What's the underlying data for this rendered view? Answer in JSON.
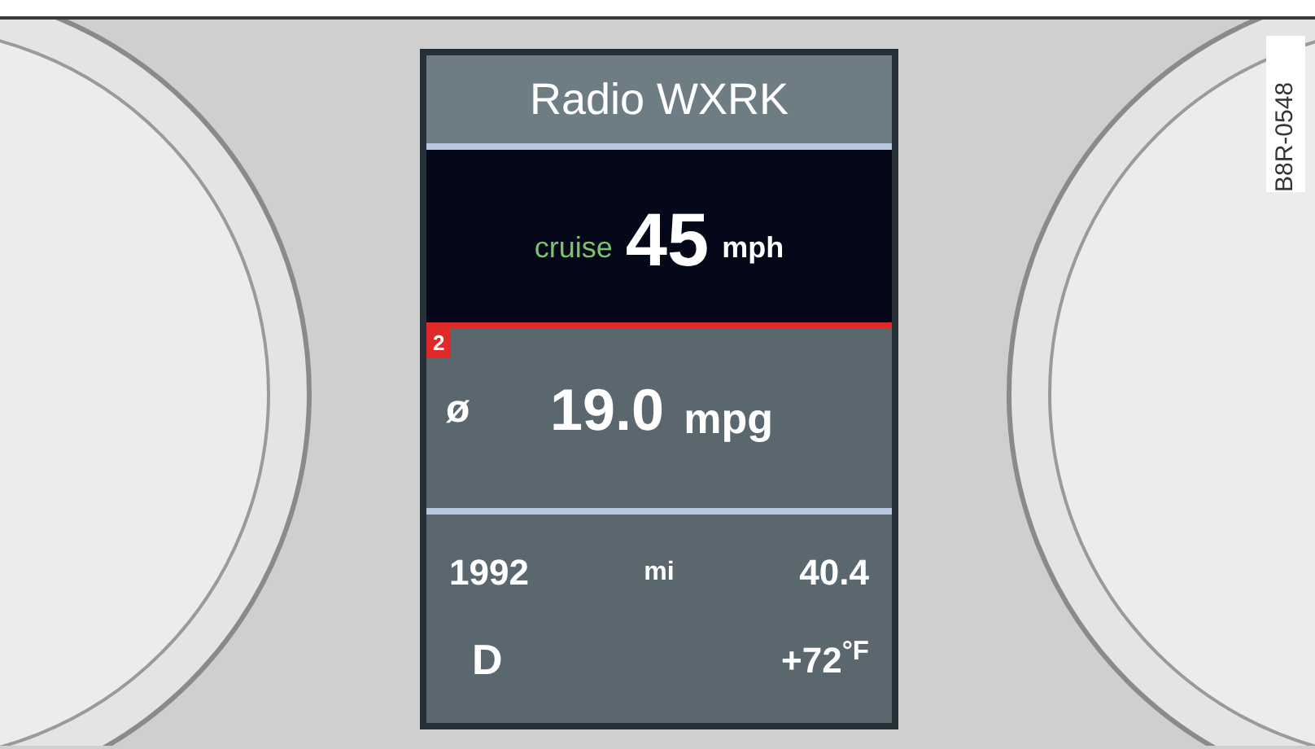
{
  "figure_code": "B8R-0548",
  "display": {
    "title": "Radio WXRK",
    "cruise": {
      "label": "cruise",
      "speed": "45",
      "unit": "mph"
    },
    "badge": "2",
    "consumption": {
      "symbol": "ø",
      "value": "19.0",
      "unit": "mpg"
    },
    "trip": {
      "distance": "1992",
      "unit": "mi",
      "reading": "40.4"
    },
    "gear": "D",
    "temperature": "+72$^{°F}$"
  }
}
